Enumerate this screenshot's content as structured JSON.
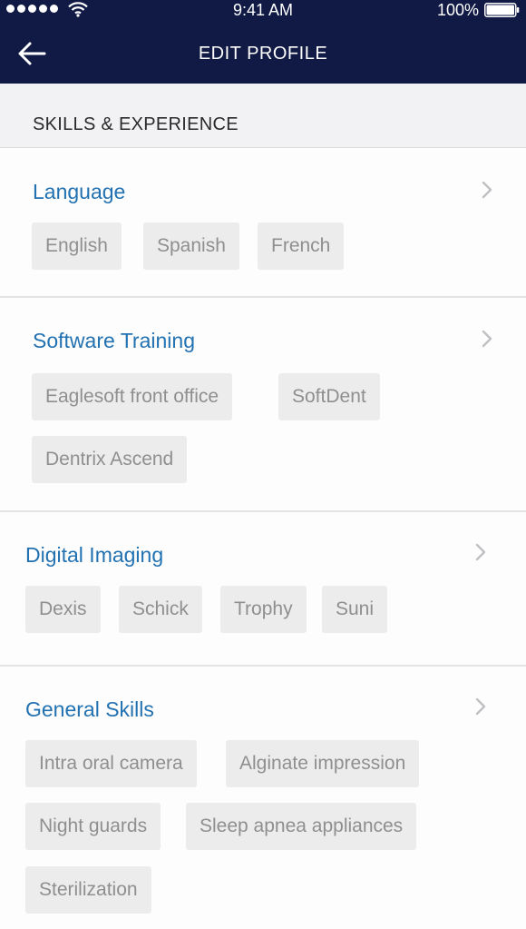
{
  "status_bar": {
    "time": "9:41 AM",
    "battery": "100%"
  },
  "nav": {
    "title": "EDIT PROFILE",
    "back_icon": "back-arrow-icon"
  },
  "section": {
    "title": "SKILLS & EXPERIENCE"
  },
  "groups": [
    {
      "title": "Language",
      "tags": [
        "English",
        "Spanish",
        "French"
      ]
    },
    {
      "title": "Software Training",
      "tags": [
        "Eaglesoft front office",
        "SoftDent",
        "Dentrix Ascend"
      ]
    },
    {
      "title": "Digital Imaging",
      "tags": [
        "Dexis",
        "Schick",
        "Trophy",
        "Suni"
      ]
    },
    {
      "title": "General Skills",
      "tags": [
        "Intra oral camera",
        "Alginate impression",
        "Night guards",
        "Sleep apnea appliances",
        "Sterilization"
      ]
    }
  ],
  "colors": {
    "nav_background": "#101a45",
    "group_title": "#2271b1",
    "tag_background": "#ececec",
    "tag_text": "#8f8f8f"
  }
}
